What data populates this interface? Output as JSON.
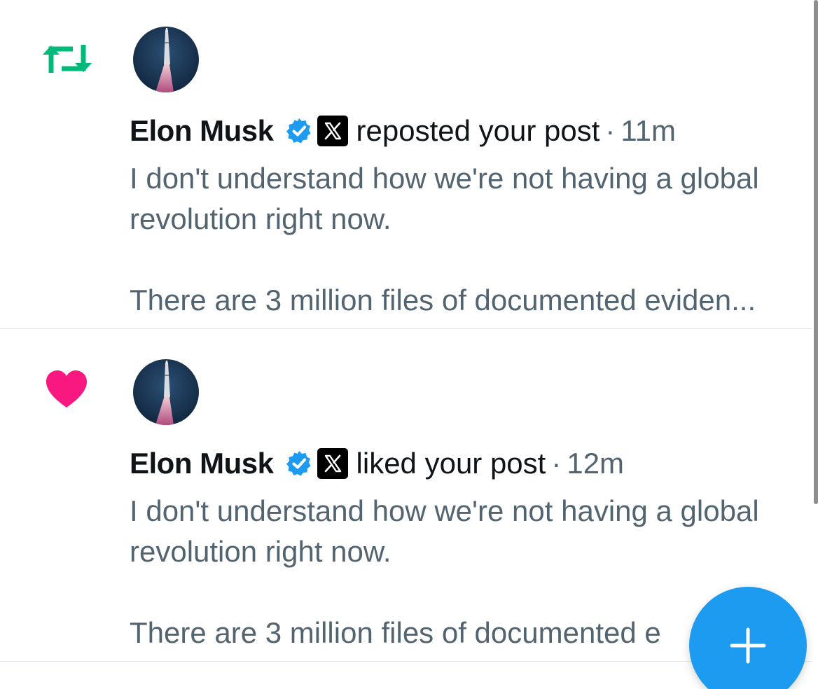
{
  "notifications": [
    {
      "type": "repost",
      "icon": "repost-icon",
      "icon_color": "#00ba7c",
      "user_name": "Elon Musk",
      "verified": true,
      "action_text": "reposted your post",
      "separator": "·",
      "time": "11m",
      "post_lines": [
        "I don't understand how we're not having a global",
        "revolution right now.",
        "",
        "There are 3 million files of documented eviden..."
      ]
    },
    {
      "type": "like",
      "icon": "heart-icon",
      "icon_color": "#f91880",
      "user_name": "Elon Musk",
      "verified": true,
      "action_text": "liked your post",
      "separator": "·",
      "time": "12m",
      "post_lines": [
        "I don't understand how we're not having a global",
        "revolution right now.",
        "",
        "There are 3 million files of documented e"
      ]
    }
  ],
  "fab": {
    "icon": "plus-icon",
    "color": "#1d9bf0"
  },
  "colors": {
    "text_primary": "#0f1419",
    "text_secondary": "#536471",
    "verified_blue": "#1d9bf0",
    "divider": "#e1e5e9"
  }
}
